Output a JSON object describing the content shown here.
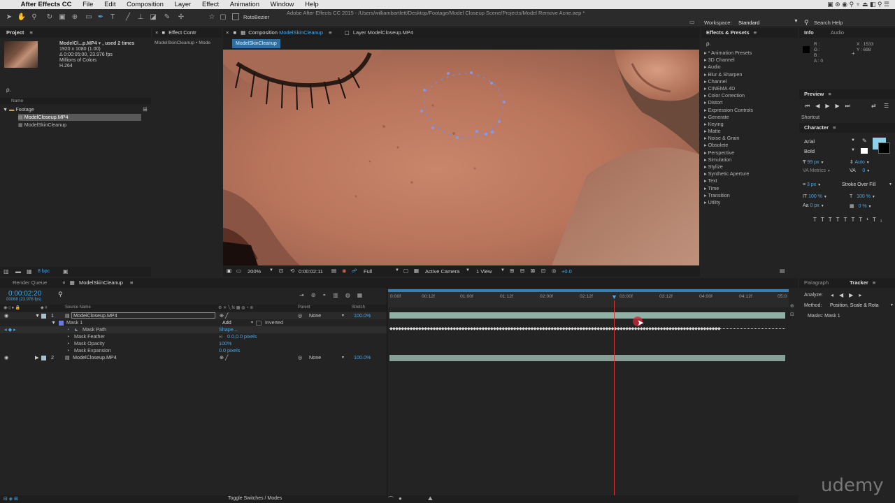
{
  "menubar": {
    "apple": "",
    "app_name": "After Effects CC",
    "items": [
      "File",
      "Edit",
      "Composition",
      "Layer",
      "Effect",
      "Animation",
      "Window",
      "Help"
    ]
  },
  "toolbar": {
    "rotobezier": "RotoBezier",
    "title": "Adobe After Effects CC 2015 - /Users/williambartlett/Desktop/Footage/Model Closeup Scene/Projects/Model Remove Acne.aep *",
    "workspace_label": "Workspace:",
    "workspace_value": "Standard",
    "search_help": "Search Help"
  },
  "project": {
    "tab": "Project",
    "footage_name": "ModelCl...p.MP4 ▾ , used 2 times",
    "footage_res": "1920 x 1080 (1.00)",
    "footage_dur": "Δ 0:00:05:00, 23.976 fps",
    "footage_colors": "Millions of Colors",
    "footage_codec": "H.264",
    "search_placeholder": "ρ.",
    "col_name": "Name",
    "items": [
      {
        "name": "Footage",
        "type": "folder"
      },
      {
        "name": "ModelCloseup.MP4",
        "type": "footage"
      },
      {
        "name": "ModelSkinCleanup",
        "type": "comp"
      }
    ],
    "bpc": "8 bpc"
  },
  "effect_controls": {
    "tab": "Effect Contr",
    "breadcrumb": "ModelSkinCleanup • Mode"
  },
  "composition": {
    "tab_prefix": "Composition",
    "tab_name": "ModelSkinCleanup",
    "layer_tab": "Layer ModelCloseup.MP4",
    "subtab": "ModelSkinCleanup",
    "zoom": "200%",
    "timecode": "0:00:02:11",
    "resolution": "Full",
    "camera": "Active Camera",
    "view": "1 View",
    "exposure": "+0.0"
  },
  "effects_presets": {
    "tab": "Effects & Presets",
    "search_placeholder": "ρ.",
    "items": [
      "* Animation Presets",
      "3D Channel",
      "Audio",
      "Blur & Sharpen",
      "Channel",
      "CINEMA 4D",
      "Color Correction",
      "Distort",
      "Expression Controls",
      "Generate",
      "Keying",
      "Matte",
      "Noise & Grain",
      "Obsolete",
      "Perspective",
      "Simulation",
      "Stylize",
      "Synthetic Aperture",
      "Text",
      "Time",
      "Transition",
      "Utility"
    ]
  },
  "info": {
    "tab_info": "Info",
    "tab_audio": "Audio",
    "r": "R :",
    "g": "G :",
    "b": "B :",
    "a": "A : 0",
    "x": "X : 1533",
    "y": "Y : 698"
  },
  "preview": {
    "tab": "Preview",
    "shortcut": "Shortcut"
  },
  "character": {
    "tab": "Character",
    "font": "Arial",
    "style": "Bold",
    "size": "99 px",
    "leading": "Auto",
    "kerning": "Metrics",
    "tracking": "0",
    "stroke_width": "3 px",
    "stroke_type": "Stroke Over Fill",
    "vscale": "100 %",
    "hscale": "100 %",
    "baseline": "0 px",
    "tsume": "0 %",
    "fill_color": "#8ed1e8"
  },
  "tracker": {
    "tab_paragraph": "Paragraph",
    "tab_tracker": "Tracker",
    "analyze": "Analyze:",
    "method_label": "Method:",
    "method_value": "Position, Scale & Rota",
    "masks": "Masks: Mask 1"
  },
  "timeline": {
    "tab_render": "Render Queue",
    "tab_comp": "ModelSkinCleanup",
    "timecode": "0:00:02:20",
    "frames": "00068 (23.976 fps)",
    "col_source": "Source Name",
    "col_parent": "Parent",
    "col_stretch": "Stretch",
    "ruler": [
      "0:00f",
      "00:12f",
      "01:00f",
      "01:12f",
      "02:00f",
      "02:12f",
      "03:00f",
      "03:12f",
      "04:00f",
      "04:12f",
      "05:0"
    ],
    "layers": [
      {
        "num": "1",
        "name": "ModelCloseup.MP4",
        "parent": "None",
        "stretch": "100.0%"
      },
      {
        "num": "2",
        "name": "ModelCloseup.MP4",
        "parent": "None",
        "stretch": "100.0%"
      }
    ],
    "mask": {
      "name": "Mask 1",
      "mode": "Add",
      "inverted": "Inverted",
      "path_label": "Mask Path",
      "path_value": "Shape...",
      "feather_label": "Mask Feather",
      "feather_value": "0.0,0.0 pixels",
      "opacity_label": "Mask Opacity",
      "opacity_value": "100%",
      "expansion_label": "Mask Expansion",
      "expansion_value": "0.0 pixels"
    },
    "toggle_label": "Toggle Switches / Modes"
  },
  "watermark": "udemy"
}
